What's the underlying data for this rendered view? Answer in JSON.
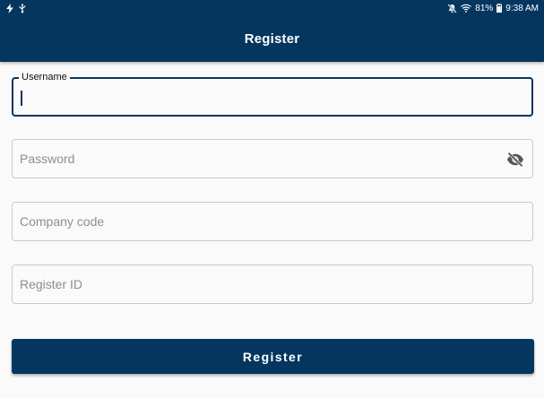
{
  "status_bar": {
    "battery": "81%",
    "time": "9:38 AM",
    "icons": [
      "flash-icon",
      "usb-icon",
      "mute-icon",
      "wifi-icon",
      "battery-icon"
    ]
  },
  "app_bar": {
    "title": "Register"
  },
  "form": {
    "username": {
      "label": "Username",
      "value": ""
    },
    "password": {
      "placeholder": "Password",
      "value": "",
      "toggle_icon": "visibility-off-icon"
    },
    "company_code": {
      "placeholder": "Company code",
      "value": ""
    },
    "register_id": {
      "placeholder": "Register ID",
      "value": ""
    }
  },
  "register_button": {
    "label": "Register"
  },
  "colors": {
    "primary": "#04365f",
    "background": "#fafafa",
    "border": "#c9c9c9",
    "placeholder": "#8e8e8e"
  }
}
